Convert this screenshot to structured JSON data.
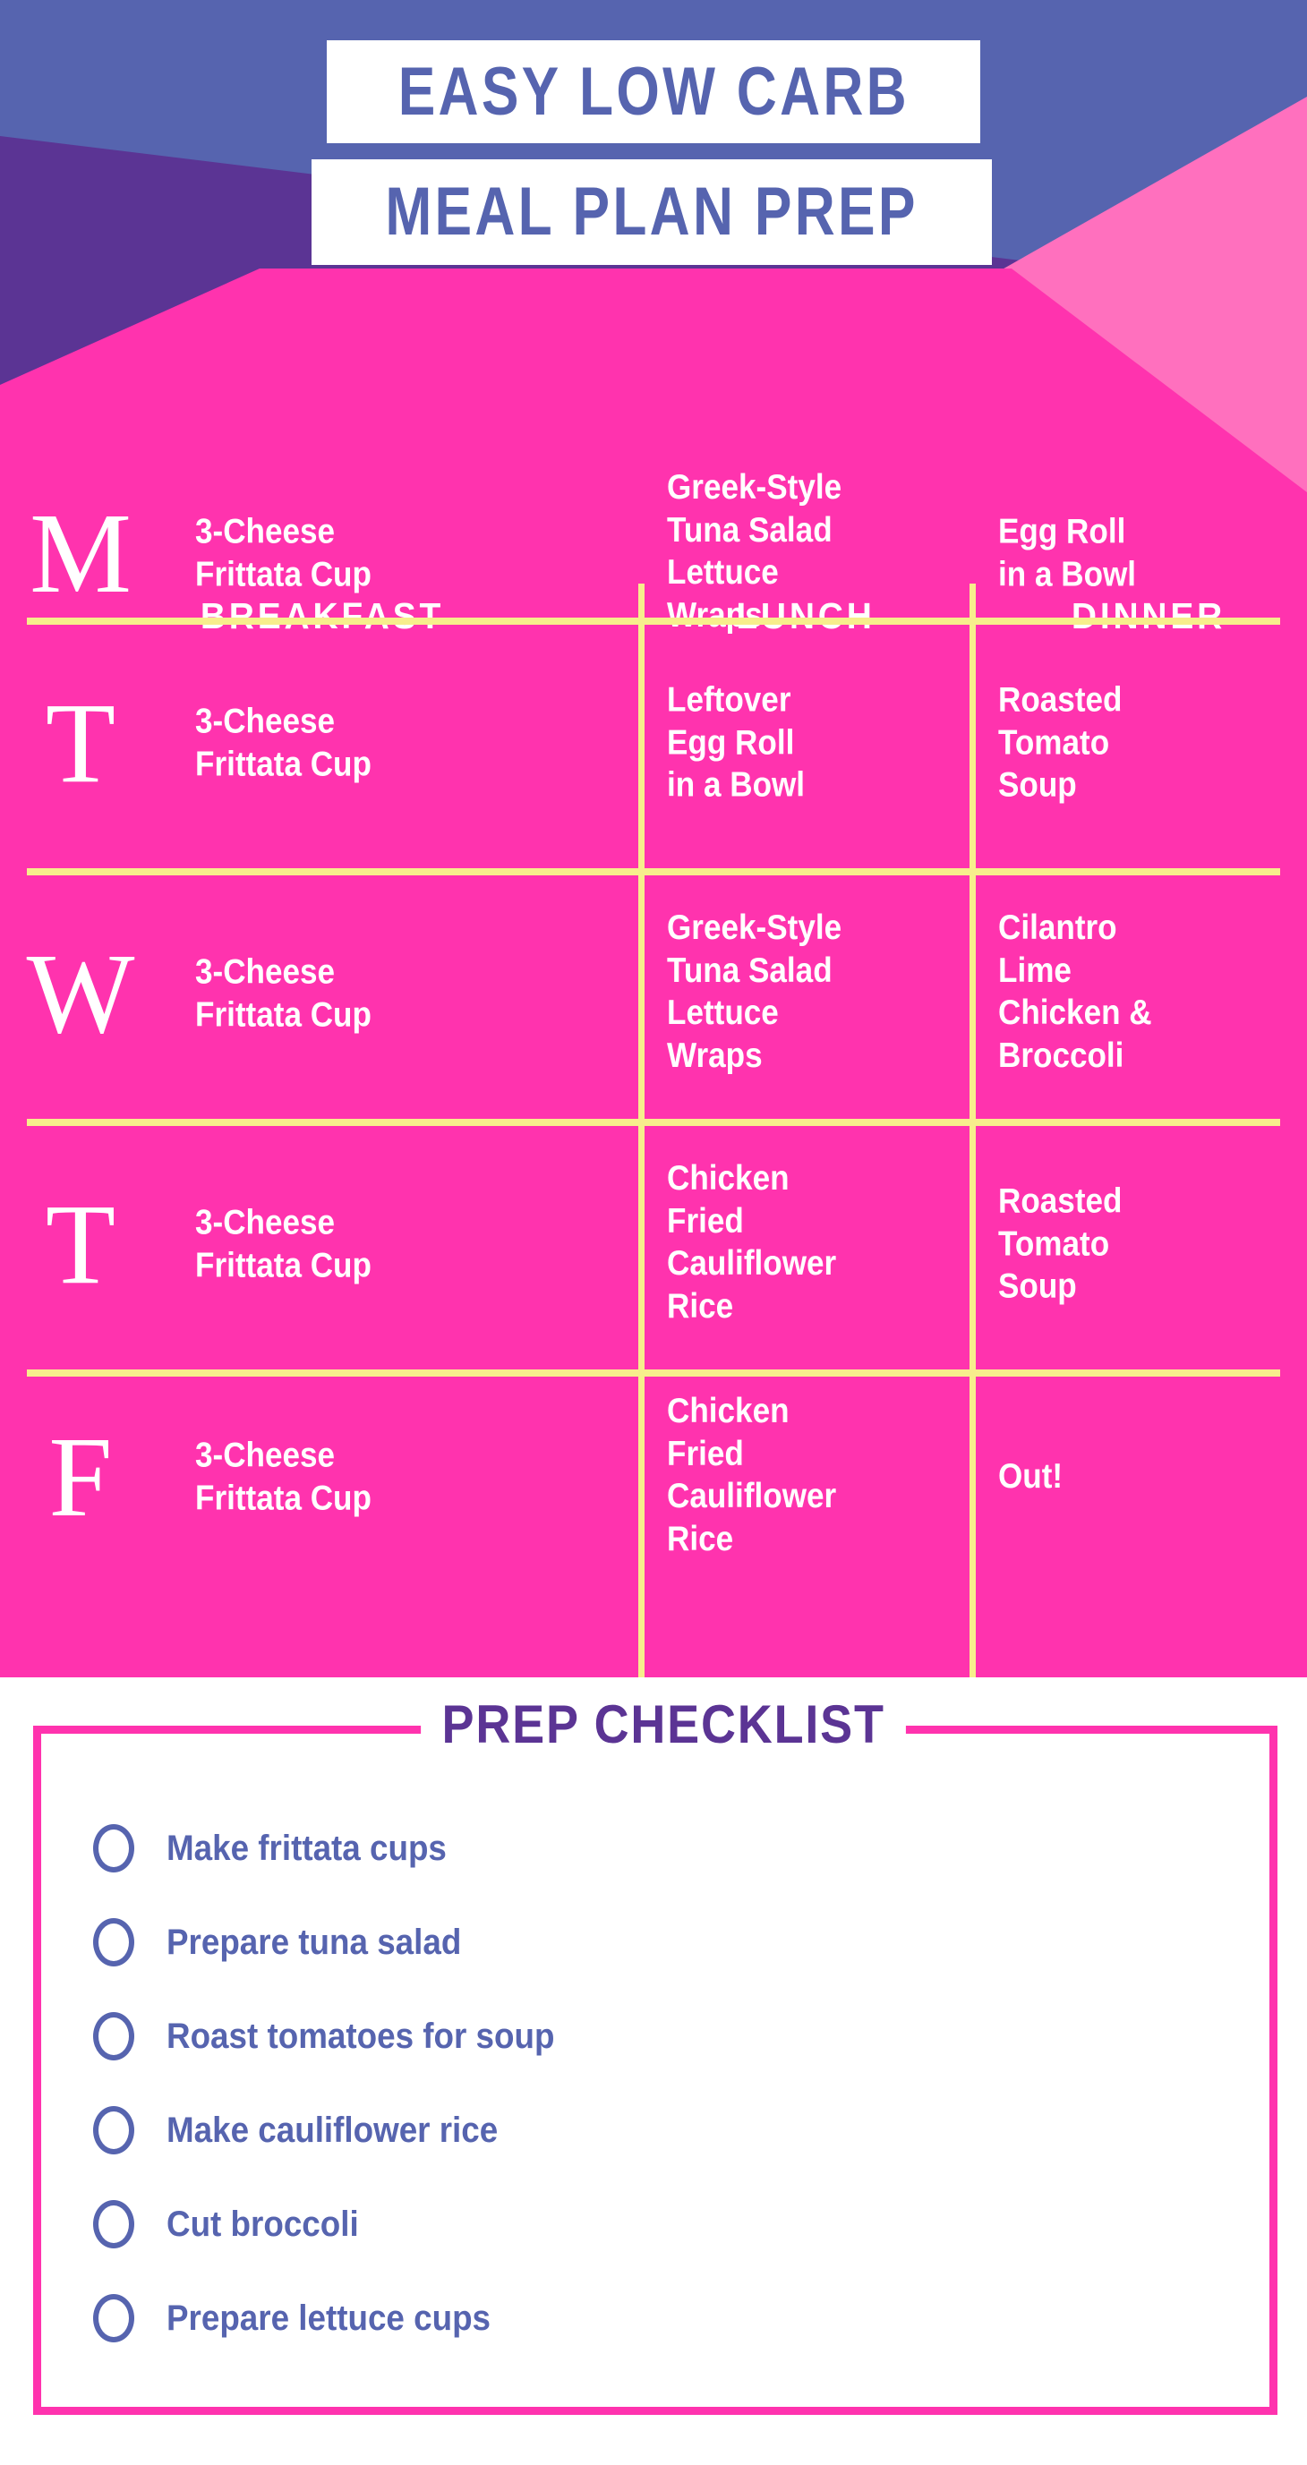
{
  "header": {
    "title_line_1": "EASY LOW CARB",
    "title_line_2": "MEAL PLAN PREP",
    "colors": {
      "blue": "#5664AF",
      "purple": "#5B3494",
      "pink": "#FF33AE",
      "light_pink": "#FF70BE",
      "yellow": "#F7EE8C",
      "white": "#FFFFFF"
    }
  },
  "meal_table": {
    "columns": [
      "BREAKFAST",
      "LUNCH",
      "DINNER"
    ],
    "rows": [
      {
        "day_letter": "M",
        "breakfast": "3-Cheese\nFrittata Cup",
        "lunch": "Greek-Style\nTuna Salad\nLettuce\nWraps",
        "dinner": "Egg Roll\nin a Bowl"
      },
      {
        "day_letter": "T",
        "breakfast": "3-Cheese\nFrittata Cup",
        "lunch": "Leftover\nEgg Roll\nin a Bowl",
        "dinner": "Roasted\nTomato\nSoup"
      },
      {
        "day_letter": "W",
        "breakfast": "3-Cheese\nFrittata Cup",
        "lunch": "Greek-Style\nTuna Salad\nLettuce\nWraps",
        "dinner": "Cilantro\nLime\nChicken &\nBroccoli"
      },
      {
        "day_letter": "T",
        "breakfast": "3-Cheese\nFrittata Cup",
        "lunch": "Chicken\nFried\nCauliflower\nRice",
        "dinner": "Roasted\nTomato\nSoup"
      },
      {
        "day_letter": "F",
        "breakfast": "3-Cheese\nFrittata Cup",
        "lunch": "Chicken\nFried\nCauliflower\nRice",
        "dinner": "Out!"
      }
    ]
  },
  "checklist": {
    "title": "PREP CHECKLIST",
    "items": [
      {
        "label": "Make frittata cups",
        "checked": false
      },
      {
        "label": "Prepare tuna salad",
        "checked": false
      },
      {
        "label": "Roast tomatoes for soup",
        "checked": false
      },
      {
        "label": "Make cauliflower rice",
        "checked": false
      },
      {
        "label": "Cut broccoli",
        "checked": false
      },
      {
        "label": "Prepare lettuce cups",
        "checked": false
      }
    ]
  }
}
